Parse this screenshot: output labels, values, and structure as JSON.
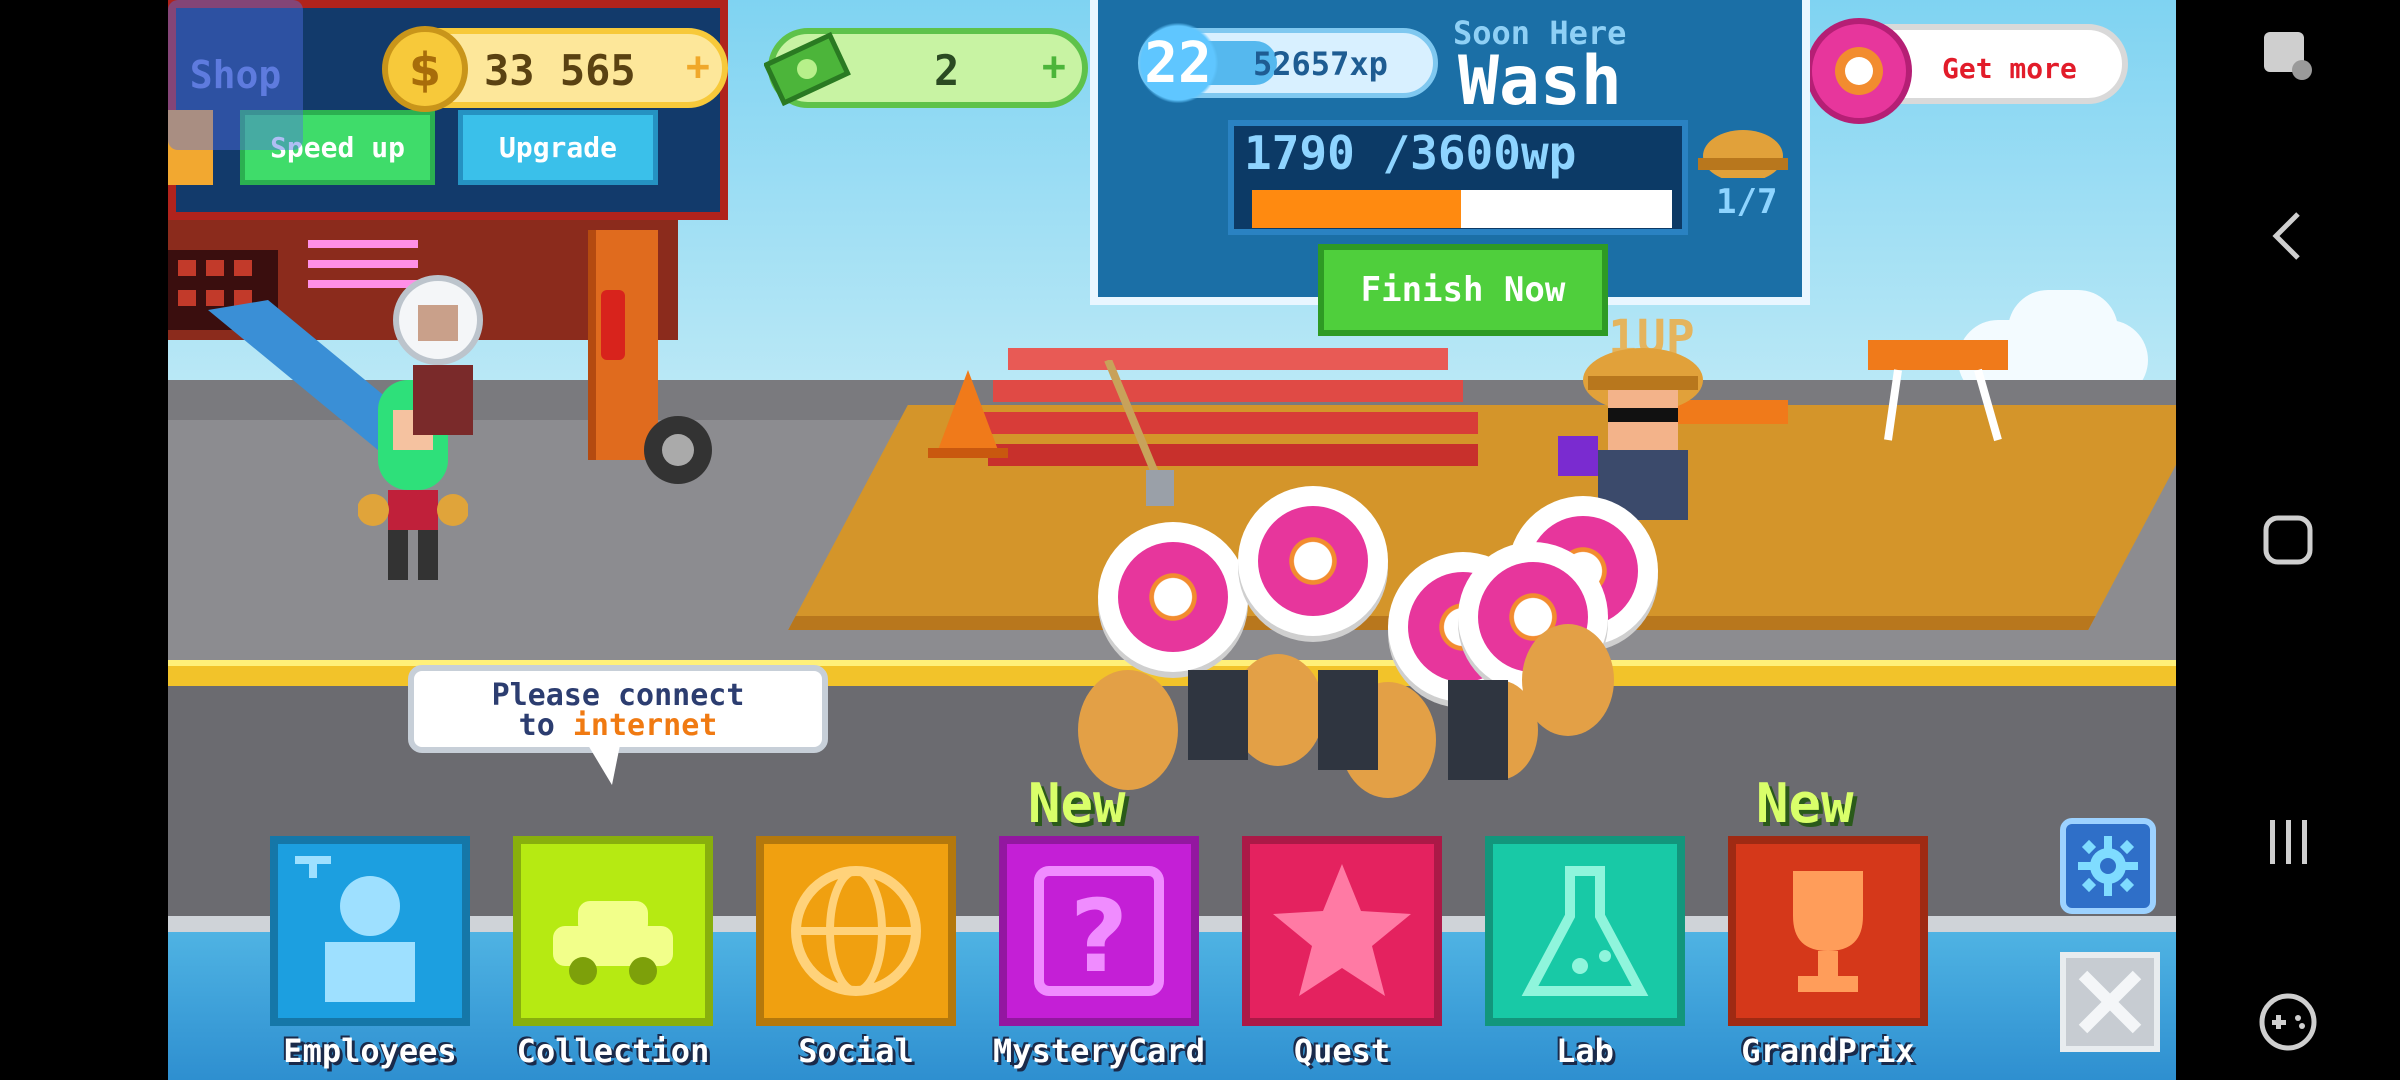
{
  "building": {
    "shop_label": "Shop",
    "speed_up_label": "Speed up",
    "upgrade_label": "Upgrade"
  },
  "hud": {
    "coins": "33 565",
    "cash": "2",
    "plus_symbol": "+",
    "donut_button_label": "Get more"
  },
  "project": {
    "level": "22",
    "xp": "52657xp",
    "xp_fraction": 0.45,
    "title_top": "Soon Here",
    "title": "Wash",
    "work_points": "1790 /3600wp",
    "progress_fraction": 0.497,
    "stage": "1/7",
    "finish_label": "Finish Now"
  },
  "bubble": {
    "line1": "Please connect",
    "line2_prefix": "to ",
    "line2_highlight": "internet"
  },
  "level_up_text": "1UP",
  "menu": [
    {
      "label": "Employees",
      "color": "#1c9fe0",
      "icon": "employee-icon"
    },
    {
      "label": "Collection",
      "color": "#b6ea12",
      "icon": "car-icon"
    },
    {
      "label": "Social",
      "color": "#f0a010",
      "icon": "globe-icon"
    },
    {
      "label": "MysteryCard",
      "color": "#c41fd6",
      "icon": "question-icon"
    },
    {
      "label": "Quest",
      "color": "#e4225f",
      "icon": "star-icon"
    },
    {
      "label": "Lab",
      "color": "#18c9a6",
      "icon": "flask-icon"
    },
    {
      "label": "GrandPrix",
      "color": "#d5381a",
      "icon": "trophy-icon"
    }
  ],
  "new_badge": "New",
  "colors": {
    "coin_gold": "#f7c93a",
    "cash_green": "#5ec24a",
    "donut_pink": "#e7369c",
    "progress_orange": "#ff8a10"
  }
}
